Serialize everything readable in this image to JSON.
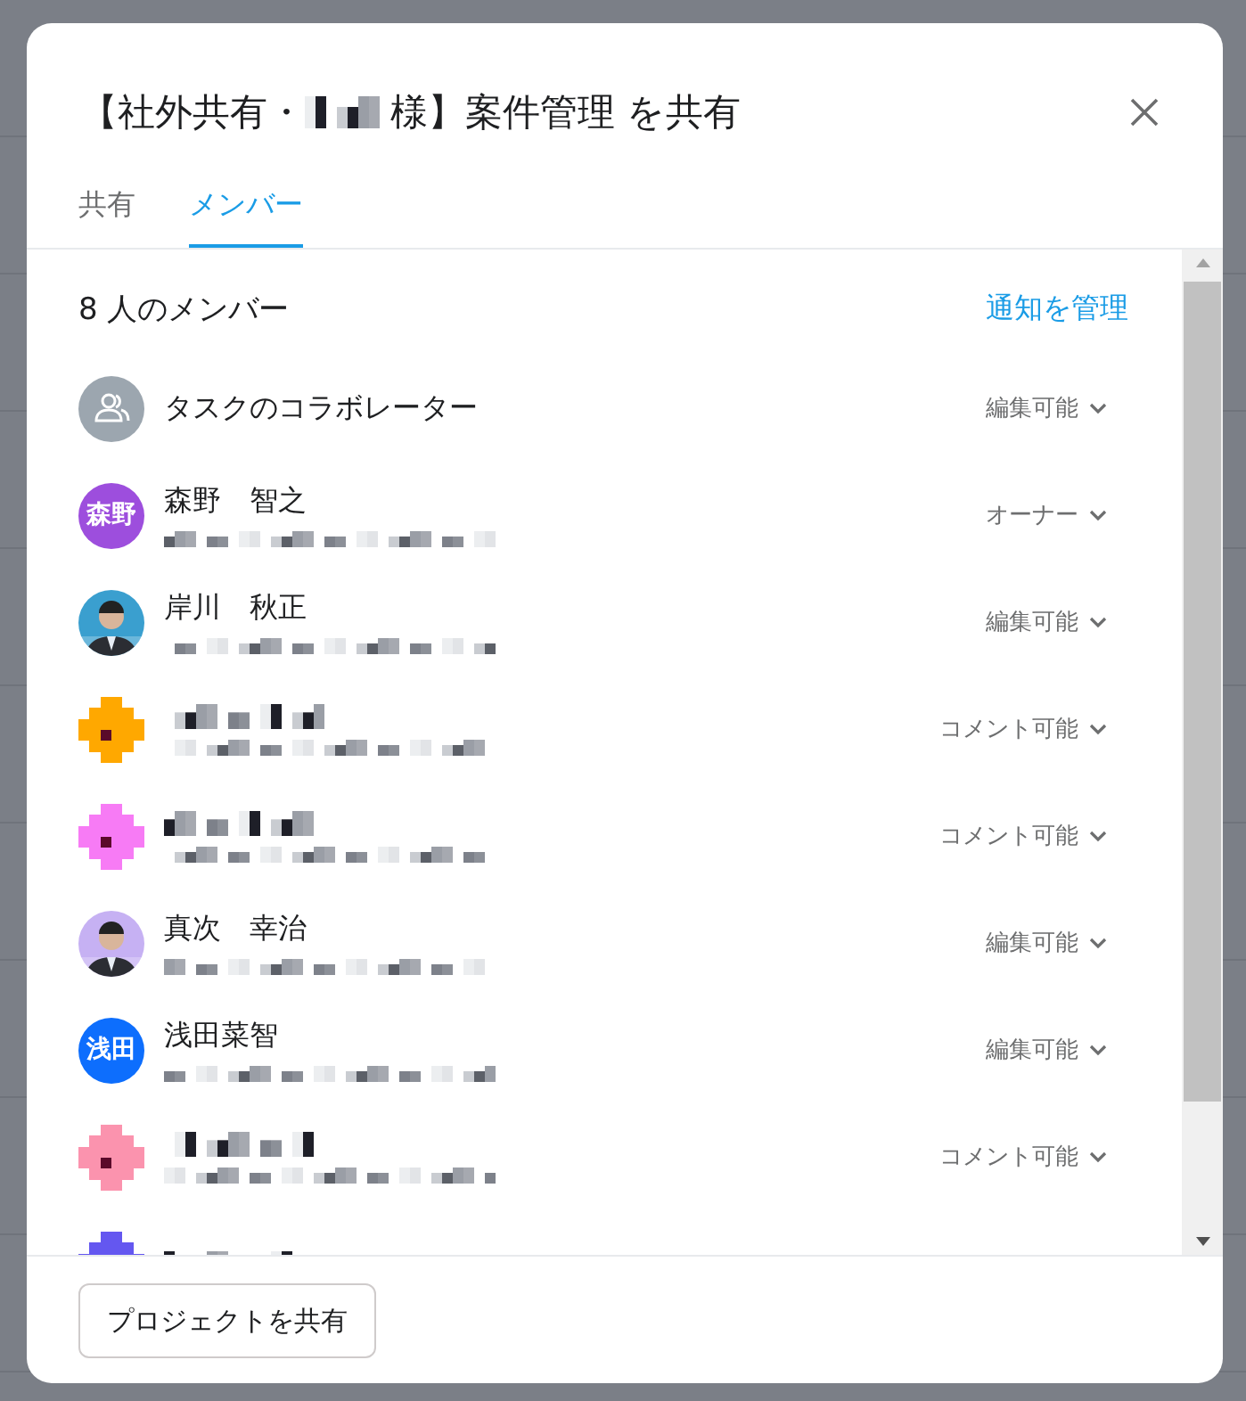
{
  "dialog": {
    "title_prefix": "【社外共有・",
    "title_suffix": "様】案件管理 を共有"
  },
  "tabs": [
    {
      "label": "共有",
      "selected": false
    },
    {
      "label": "メンバー",
      "selected": true
    }
  ],
  "members_header": {
    "count": "8 人のメンバー",
    "manage_link": "通知を管理"
  },
  "members": [
    {
      "kind": "group",
      "name": "タスクのコラボレーター",
      "role": "編集可能"
    },
    {
      "kind": "initials",
      "initials": "森野",
      "color": "#9d4edd",
      "name": "森野　智之",
      "role": "オーナー"
    },
    {
      "color": "#3a9fcf",
      "name": "岸川　秋正",
      "role": "編集可能"
    },
    {
      "kind": "pixel",
      "color": "#ffa800",
      "role": "コメント可能"
    },
    {
      "kind": "pixel",
      "color": "#f77bf5",
      "role": "コメント可能"
    },
    {
      "color": "#c6b1f3",
      "name": "真次　幸治",
      "role": "編集可能"
    },
    {
      "kind": "initials",
      "initials": "浅田",
      "color": "#0d6efd",
      "name": "浅田菜智",
      "role": "編集可能"
    },
    {
      "kind": "pixel",
      "color": "#fb93ae",
      "role": "コメント可能"
    },
    {
      "kind": "pixel",
      "color": "#6457f0"
    }
  ],
  "footer": {
    "button": "プロジェクトを共有"
  }
}
